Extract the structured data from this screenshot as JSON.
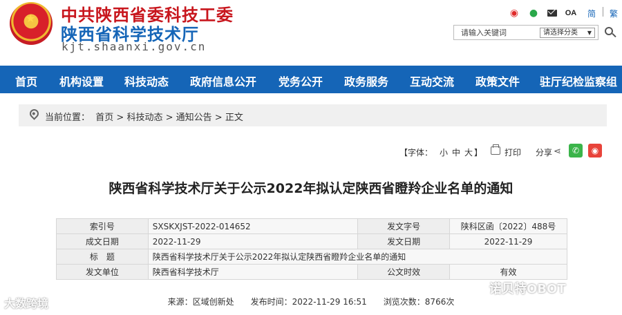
{
  "header": {
    "title_party": "中共陕西省委科技工委",
    "title_dept": "陕西省科学技术厅",
    "domain": "kjt.shaanxi.gov.cn",
    "top_links": {
      "oa": "OA",
      "simplified": "简",
      "traditional": "繁"
    },
    "search": {
      "placeholder": "请输入关键词",
      "category": "请选择分类"
    }
  },
  "nav": {
    "items": [
      "首页",
      "机构设置",
      "科技动态",
      "政府信息公开",
      "党务公开",
      "政务服务",
      "互动交流",
      "政策文件",
      "驻厅纪检监察组"
    ]
  },
  "breadcrumb": {
    "prefix": "当前位置：",
    "items": [
      "首页",
      "科技动态",
      "通知公告",
      "正文"
    ],
    "separator": " > "
  },
  "tools": {
    "font_label": "【字体：",
    "font_small": "小",
    "font_medium": "中",
    "font_large": "大",
    "font_close": "】",
    "print": "打印",
    "share": "分享"
  },
  "article": {
    "title": "陕西省科学技术厅关于公示2022年拟认定陕西省瞪羚企业名单的通知",
    "meta": {
      "index_label": "索引号",
      "index_value": "SXSKXJST-2022-014652",
      "docno_label": "发文字号",
      "docno_value": "陕科区函〔2022〕488号",
      "created_label": "成文日期",
      "created_value": "2022-11-29",
      "issued_label": "发文日期",
      "issued_value": "2022-11-29",
      "subject_label": "标　题",
      "subject_value": "陕西省科学技术厅关于公示2022年拟认定陕西省瞪羚企业名单的通知",
      "issuer_label": "发文单位",
      "issuer_value": "陕西省科学技术厅",
      "validity_label": "公文时效",
      "validity_value": "有效"
    },
    "source_line": "来源：区域创新处　　发布时间：2022-11-29 16:51　　浏览次数：8766次"
  },
  "watermarks": {
    "left": "大数跨境",
    "right": "诺贝特OBOT"
  }
}
